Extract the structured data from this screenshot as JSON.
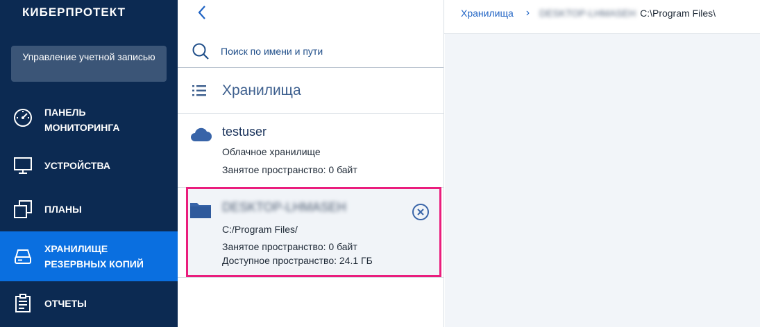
{
  "brand": {
    "logo_text": "КИБЕРПРОТЕКТ"
  },
  "sidebar": {
    "account_button": "Управление учетной записью",
    "items": [
      {
        "label_line1": "Панель",
        "label_line2": "мониторинга",
        "icon": "dashboard-gauge-icon"
      },
      {
        "label_line1": "Устройства",
        "label_line2": "",
        "icon": "monitor-icon"
      },
      {
        "label_line1": "Планы",
        "label_line2": "",
        "icon": "plans-icon"
      },
      {
        "label_line1": "Хранилище",
        "label_line2": "резервных копий",
        "icon": "storage-drive-icon"
      },
      {
        "label_line1": "Отчеты",
        "label_line2": "",
        "icon": "report-clipboard-icon"
      }
    ],
    "active_index": 3,
    "colors": {
      "background": "#0c2a52",
      "active": "#0a6fe0",
      "account_button": "#3b5577"
    }
  },
  "middle": {
    "search": {
      "placeholder": "Поиск по имени и пути",
      "value": ""
    },
    "section_title": "Хранилища",
    "storages": [
      {
        "name": "testuser",
        "type_line": "Облачное хранилище",
        "used_line": "Занятое пространство: 0 байт",
        "icon": "cloud-icon"
      },
      {
        "name": "DESKTOP-LHMASEH",
        "path_line": "C:/Program Files/",
        "used_line": "Занятое пространство: 0 байт",
        "available_line": "Доступное пространство: 24.1 ГБ",
        "icon": "folder-icon",
        "highlight_color": "#ea1d7d"
      }
    ]
  },
  "breadcrumb": {
    "root": "Хранилища",
    "machine": "DESKTOP-LHMASEH",
    "current": "C:\\Program Files\\"
  }
}
